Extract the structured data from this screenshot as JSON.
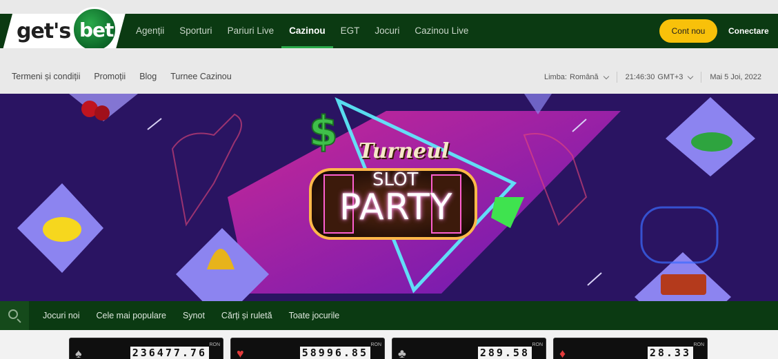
{
  "brand": {
    "logo_left": "get's",
    "logo_right": "bet"
  },
  "nav": {
    "items": [
      {
        "label": "Agenții"
      },
      {
        "label": "Sporturi"
      },
      {
        "label": "Pariuri Live"
      },
      {
        "label": "Cazinou",
        "active": true
      },
      {
        "label": "EGT"
      },
      {
        "label": "Jocuri"
      },
      {
        "label": "Cazinou Live"
      }
    ],
    "signup": "Cont nou",
    "login": "Conectare"
  },
  "subnav": {
    "links": [
      "Termeni și condiții",
      "Promoții",
      "Blog",
      "Turnee Cazinou"
    ],
    "language_label": "Limba:",
    "language_value": "Română",
    "time": "21:46:30",
    "timezone": "GMT+3",
    "date": "Mai 5 Joi, 2022"
  },
  "banner": {
    "title_script": "Turneul",
    "title_slot": "SLOT",
    "title_party": "PARTY"
  },
  "categories": [
    "Jocuri noi",
    "Cele mai populare",
    "Synot",
    "Cărți și ruletă",
    "Toate jocurile"
  ],
  "jackpots": [
    {
      "suit": "♠",
      "value": "236477.76",
      "currency": "RON",
      "suit_color": "#bbbbbb"
    },
    {
      "suit": "♥",
      "value": "58996.85",
      "currency": "RON",
      "suit_color": "#e23b3b"
    },
    {
      "suit": "♣",
      "value": "289.58",
      "currency": "RON",
      "suit_color": "#bbbbbb"
    },
    {
      "suit": "♦",
      "value": "28.33",
      "currency": "RON",
      "suit_color": "#e23b3b"
    }
  ],
  "colors": {
    "accent": "#f8c10a",
    "nav_bg": "#0b3a12",
    "active_underline": "#2aa94a"
  }
}
